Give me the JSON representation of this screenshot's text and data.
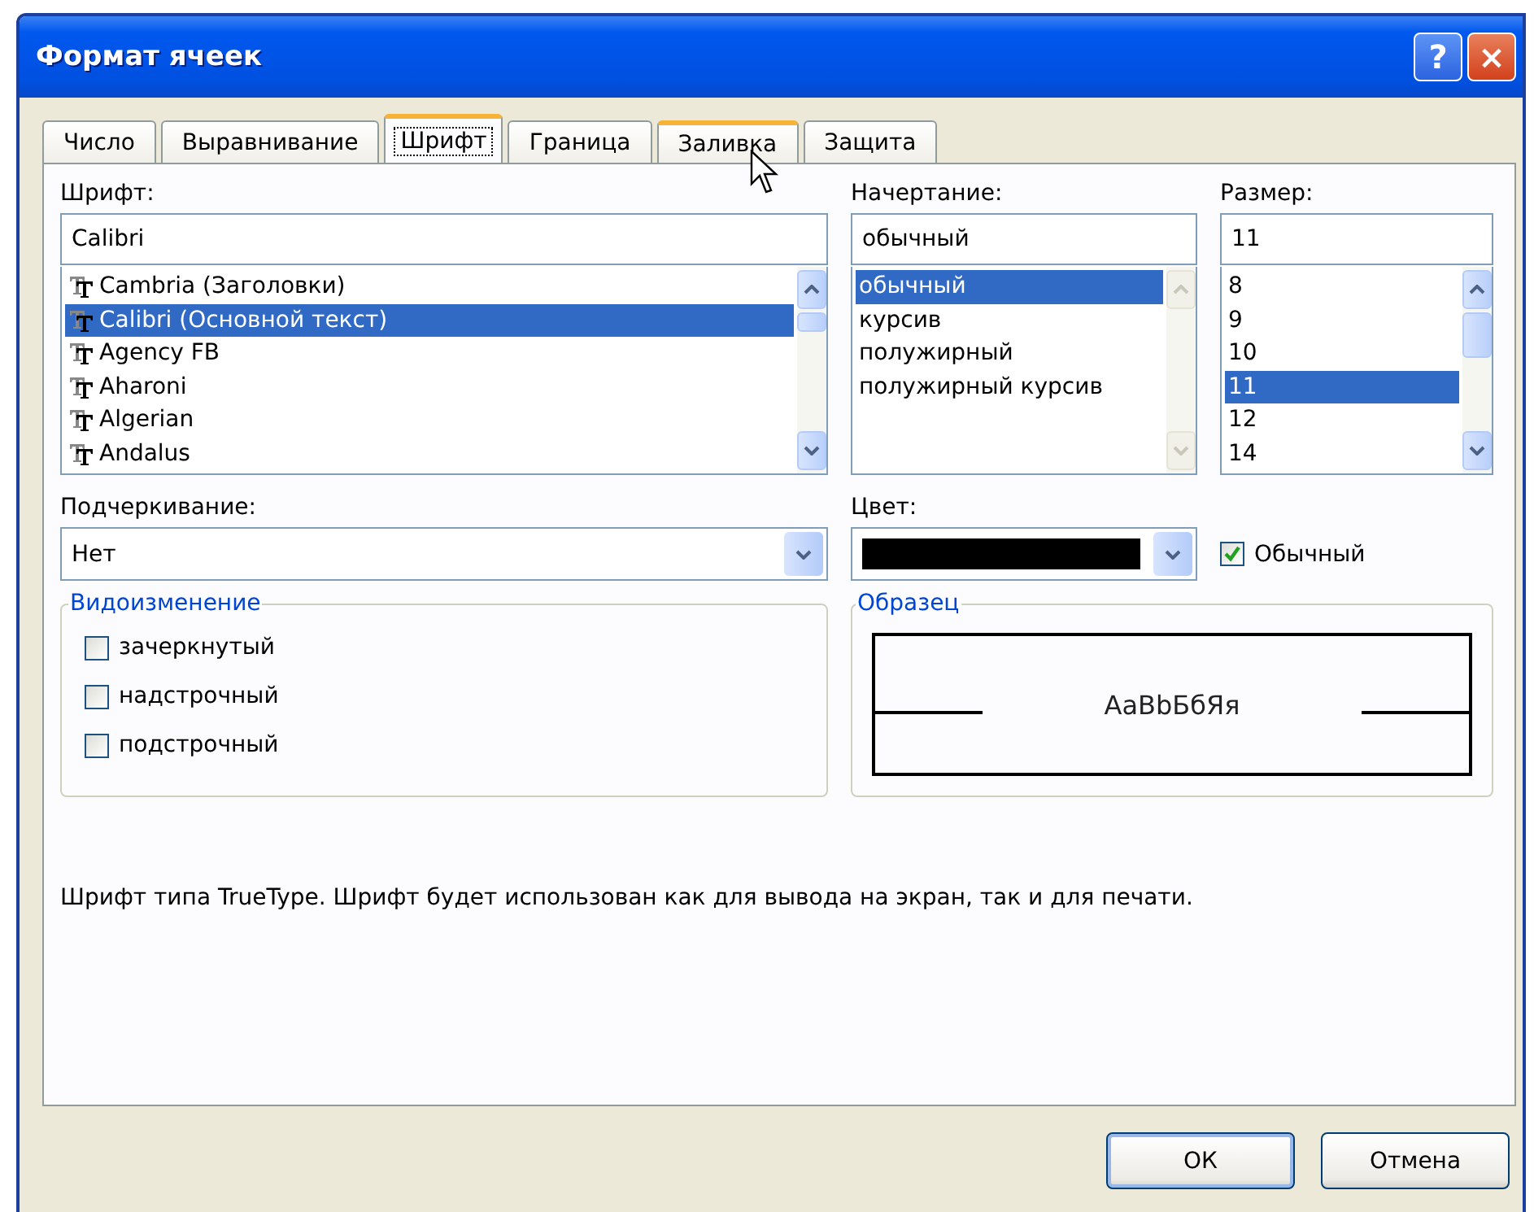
{
  "window": {
    "title": "Формат ячеек",
    "buttons": [
      "?",
      "×"
    ]
  },
  "tabs": [
    {
      "label": "Число",
      "selected": false,
      "hovered": false
    },
    {
      "label": "Выравнивание",
      "selected": false,
      "hovered": false
    },
    {
      "label": "Шрифт",
      "selected": true,
      "hovered": false
    },
    {
      "label": "Граница",
      "selected": false,
      "hovered": false
    },
    {
      "label": "Заливка",
      "selected": false,
      "hovered": true
    },
    {
      "label": "Защита",
      "selected": false,
      "hovered": false
    }
  ],
  "font": {
    "label": "Шрифт:",
    "value": "Calibri",
    "scrollbar_enabled": true,
    "items": [
      {
        "name": "Cambria (Заголовки)",
        "selected": false
      },
      {
        "name": "Calibri (Основной текст)",
        "selected": true
      },
      {
        "name": "Agency FB",
        "selected": false
      },
      {
        "name": "Aharoni",
        "selected": false
      },
      {
        "name": "Algerian",
        "selected": false
      },
      {
        "name": "Andalus",
        "selected": false
      }
    ]
  },
  "style": {
    "label": "Начертание:",
    "value": "обычный",
    "scrollbar_enabled": false,
    "items": [
      {
        "name": "обычный",
        "selected": true
      },
      {
        "name": "курсив",
        "selected": false
      },
      {
        "name": "полужирный",
        "selected": false
      },
      {
        "name": "полужирный курсив",
        "selected": false
      }
    ]
  },
  "size": {
    "label": "Размер:",
    "value": "11",
    "scrollbar_enabled": true,
    "items": [
      {
        "name": "8",
        "selected": false
      },
      {
        "name": "9",
        "selected": false
      },
      {
        "name": "10",
        "selected": false
      },
      {
        "name": "11",
        "selected": true
      },
      {
        "name": "12",
        "selected": false
      },
      {
        "name": "14",
        "selected": false
      }
    ]
  },
  "underline": {
    "label": "Подчеркивание:",
    "value": "Нет"
  },
  "color": {
    "label": "Цвет:",
    "color": "#000000",
    "normal_label": "Обычный",
    "normal_checked": true
  },
  "effects": {
    "title": "Видоизменение",
    "items": [
      {
        "label": "зачеркнутый",
        "checked": false
      },
      {
        "label": "надстрочный",
        "checked": false
      },
      {
        "label": "подстрочный",
        "checked": false
      }
    ]
  },
  "preview": {
    "title": "Образец",
    "text": "AaBbБбЯя"
  },
  "description": "Шрифт типа TrueType. Шрифт будет использован как для вывода на экран, так и для печати.",
  "buttons": [
    "ОК",
    "Отмена"
  ]
}
